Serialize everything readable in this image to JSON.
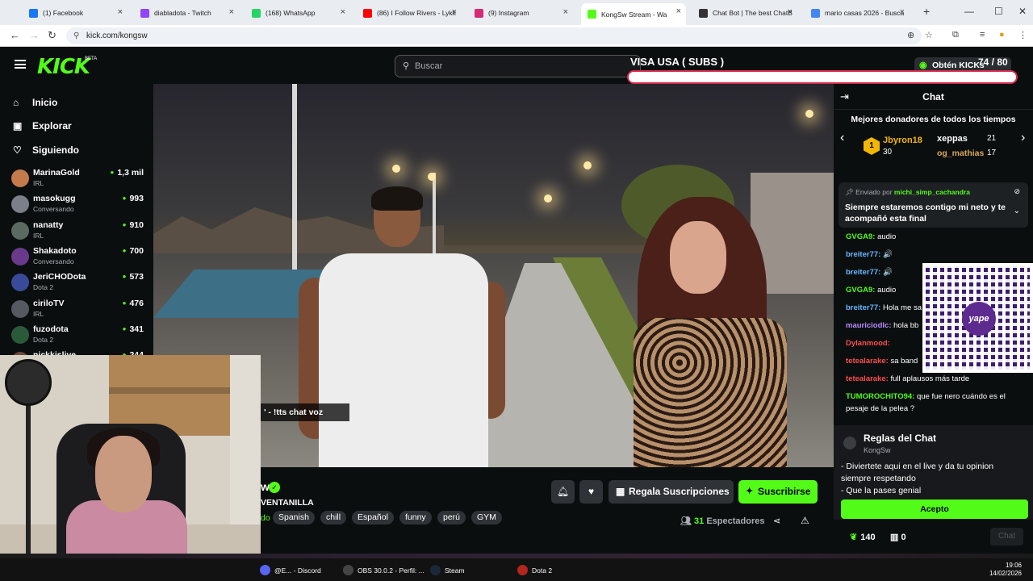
{
  "browser": {
    "tabs": [
      {
        "title": "(1) Facebook",
        "color": "#1877f2"
      },
      {
        "title": "diabladota - Twitch",
        "color": "#9146ff"
      },
      {
        "title": "(168) WhatsApp",
        "color": "#25d366"
      },
      {
        "title": "(86) I Follow Rivers - Lykk",
        "color": "#ff0000"
      },
      {
        "title": "(9) Instagram",
        "color": "#d62976"
      },
      {
        "title": "KongSw Stream - Wa",
        "color": "#53fc18"
      },
      {
        "title": "Chat Bot | The best ChatB",
        "color": "#333333"
      },
      {
        "title": "mario casas 2026 - Busca",
        "color": "#4285f4"
      }
    ],
    "new_tab": "+",
    "url": "kick.com/kongsw"
  },
  "header": {
    "logo": "KICK",
    "beta": "BETA",
    "search_placeholder": "Buscar",
    "overlay_goal_title": "VISA USA ( SUBS )",
    "goal_progress": "74 / 80",
    "goal_fraction": 0.925,
    "get_kicks": "Obtén KICKs"
  },
  "sidebar": {
    "nav": [
      {
        "label": "Inicio",
        "icon": "home-icon"
      },
      {
        "label": "Explorar",
        "icon": "explore-icon"
      },
      {
        "label": "Siguiendo",
        "icon": "heart-icon"
      }
    ],
    "channels": [
      {
        "name": "MarinaGold",
        "category": "IRL",
        "viewers": "1,3 mil",
        "color": "#c47a4a"
      },
      {
        "name": "masokugg",
        "category": "Conversando",
        "viewers": "993",
        "color": "#7a7f88"
      },
      {
        "name": "nanatty",
        "category": "IRL",
        "viewers": "910",
        "color": "#5a6a60"
      },
      {
        "name": "Shakadoto",
        "category": "Conversando",
        "viewers": "700",
        "color": "#6a3a8a"
      },
      {
        "name": "JeriCHODota",
        "category": "Dota 2",
        "viewers": "573",
        "color": "#3a4a9a"
      },
      {
        "name": "ciriloTV",
        "category": "IRL",
        "viewers": "476",
        "color": "#555a60"
      },
      {
        "name": "fuzodota",
        "category": "Dota 2",
        "viewers": "341",
        "color": "#2a5a3a"
      },
      {
        "name": "nickkislive",
        "category": "",
        "viewers": "244",
        "color": "#6a4a3a"
      }
    ]
  },
  "video": {
    "tts_overlay": "' - !tts chat voz"
  },
  "stream": {
    "name_fragment": "w",
    "title_fragment": "VENTANILLA",
    "category_fragment": "do",
    "tags": [
      "Spanish",
      "chill",
      "Español",
      "funny",
      "perú",
      "GYM"
    ],
    "gift_subs": "Regala Suscripciones",
    "subscribe": "Suscribirse",
    "viewer_count": "31",
    "viewer_label": "Espectadores"
  },
  "chat": {
    "title": "Chat",
    "donors_header": "Mejores donadores de todos los tiempos",
    "donors": [
      {
        "rank": "1",
        "name": "Jbyron18",
        "amount": "30"
      },
      {
        "name": "xeppas",
        "amount": "21"
      },
      {
        "name": "og_mathias",
        "amount": "17"
      }
    ],
    "pinned": {
      "sent_by_label": "Enviado por",
      "sent_by_user": "michi_simp_cachandra",
      "message": "Siempre estaremos contigo mi neto y te acompañó esta final"
    },
    "messages": [
      {
        "user": "GVGA9:",
        "text": "audio",
        "color": "#53fc18"
      },
      {
        "user": "breiter77:",
        "text": "🔊",
        "color": "#6ab7ff"
      },
      {
        "user": "breiter77:",
        "text": "🔊",
        "color": "#6ab7ff"
      },
      {
        "user": "GVGA9:",
        "text": "audio",
        "color": "#53fc18"
      },
      {
        "user": "breiter77:",
        "text": "Hola me sa",
        "color": "#6ab7ff"
      },
      {
        "user": "mauriciodlc:",
        "text": "hola bb",
        "color": "#b98cff"
      },
      {
        "user": "Dylanmood:",
        "text": "",
        "color": "#ff4d4d"
      },
      {
        "user": "tetealarake:",
        "text": "sa band",
        "color": "#ff4d4d"
      },
      {
        "user": "tetealarake:",
        "text": "full aplausos más tarde",
        "color": "#ff4d4d"
      },
      {
        "user": "TUMOROCHITO94:",
        "text": "que fue nero cuándo es el",
        "color": "#53fc18"
      },
      {
        "user": "",
        "text": "pesaje de la pelea ?",
        "color": "#ffffff"
      }
    ],
    "qr_label": "yape",
    "rules": {
      "title": "Reglas del Chat",
      "user": "KongSw",
      "line1": "- Diviertete aqui en el live y da tu opinion",
      "line2": "siempre respetando",
      "line3": "- Que la pases genial",
      "accept": "Acepto"
    },
    "points": "140",
    "store": "0",
    "send": "Chat"
  },
  "taskbar": {
    "items": [
      {
        "label": "@E... - Discord",
        "color": "#5865f2"
      },
      {
        "label": "OBS 30.0.2 - Perfil: ...",
        "color": "#444444"
      },
      {
        "label": "Steam",
        "color": "#1b2838"
      },
      {
        "label": "Dota 2",
        "color": "#b3261e"
      }
    ],
    "time": "19:06",
    "date": "14/02/2026"
  }
}
